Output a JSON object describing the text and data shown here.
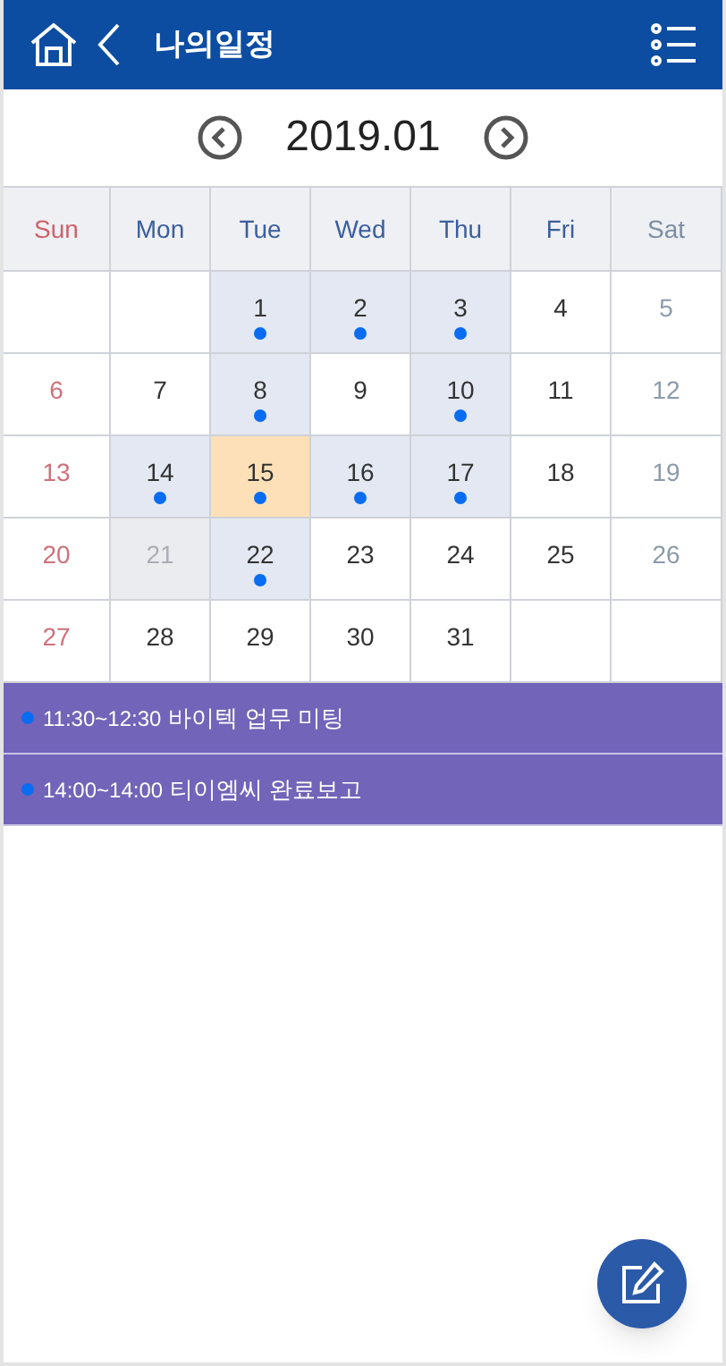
{
  "header": {
    "title": "나의일정"
  },
  "month": {
    "label": "2019.01"
  },
  "weekdays": [
    {
      "label": "Sun",
      "kind": "sun"
    },
    {
      "label": "Mon",
      "kind": "weekday"
    },
    {
      "label": "Tue",
      "kind": "weekday"
    },
    {
      "label": "Wed",
      "kind": "weekday"
    },
    {
      "label": "Thu",
      "kind": "weekday"
    },
    {
      "label": "Fri",
      "kind": "weekday"
    },
    {
      "label": "Sat",
      "kind": "sat"
    }
  ],
  "weeks": [
    [
      {
        "kind": "empty"
      },
      {
        "kind": "empty"
      },
      {
        "kind": "day",
        "day": "1",
        "has_event": true,
        "selected": false,
        "disabled": false
      },
      {
        "kind": "day",
        "day": "2",
        "has_event": true,
        "selected": false,
        "disabled": false
      },
      {
        "kind": "day",
        "day": "3",
        "has_event": true,
        "selected": false,
        "disabled": false
      },
      {
        "kind": "day",
        "day": "4",
        "has_event": false,
        "selected": false,
        "disabled": false
      },
      {
        "kind": "day",
        "day": "5",
        "has_event": false,
        "selected": false,
        "disabled": false
      }
    ],
    [
      {
        "kind": "day",
        "day": "6",
        "has_event": false,
        "selected": false,
        "disabled": false
      },
      {
        "kind": "day",
        "day": "7",
        "has_event": false,
        "selected": false,
        "disabled": false
      },
      {
        "kind": "day",
        "day": "8",
        "has_event": true,
        "selected": false,
        "disabled": false
      },
      {
        "kind": "day",
        "day": "9",
        "has_event": false,
        "selected": false,
        "disabled": false
      },
      {
        "kind": "day",
        "day": "10",
        "has_event": true,
        "selected": false,
        "disabled": false
      },
      {
        "kind": "day",
        "day": "11",
        "has_event": false,
        "selected": false,
        "disabled": false
      },
      {
        "kind": "day",
        "day": "12",
        "has_event": false,
        "selected": false,
        "disabled": false
      }
    ],
    [
      {
        "kind": "day",
        "day": "13",
        "has_event": false,
        "selected": false,
        "disabled": false
      },
      {
        "kind": "day",
        "day": "14",
        "has_event": true,
        "selected": false,
        "disabled": false
      },
      {
        "kind": "day",
        "day": "15",
        "has_event": true,
        "selected": true,
        "disabled": false
      },
      {
        "kind": "day",
        "day": "16",
        "has_event": true,
        "selected": false,
        "disabled": false
      },
      {
        "kind": "day",
        "day": "17",
        "has_event": true,
        "selected": false,
        "disabled": false
      },
      {
        "kind": "day",
        "day": "18",
        "has_event": false,
        "selected": false,
        "disabled": false
      },
      {
        "kind": "day",
        "day": "19",
        "has_event": false,
        "selected": false,
        "disabled": false
      }
    ],
    [
      {
        "kind": "day",
        "day": "20",
        "has_event": false,
        "selected": false,
        "disabled": false
      },
      {
        "kind": "day",
        "day": "21",
        "has_event": false,
        "selected": false,
        "disabled": true
      },
      {
        "kind": "day",
        "day": "22",
        "has_event": true,
        "selected": false,
        "disabled": false
      },
      {
        "kind": "day",
        "day": "23",
        "has_event": false,
        "selected": false,
        "disabled": false
      },
      {
        "kind": "day",
        "day": "24",
        "has_event": false,
        "selected": false,
        "disabled": false
      },
      {
        "kind": "day",
        "day": "25",
        "has_event": false,
        "selected": false,
        "disabled": false
      },
      {
        "kind": "day",
        "day": "26",
        "has_event": false,
        "selected": false,
        "disabled": false
      }
    ],
    [
      {
        "kind": "day",
        "day": "27",
        "has_event": false,
        "selected": false,
        "disabled": false
      },
      {
        "kind": "day",
        "day": "28",
        "has_event": false,
        "selected": false,
        "disabled": false
      },
      {
        "kind": "day",
        "day": "29",
        "has_event": false,
        "selected": false,
        "disabled": false
      },
      {
        "kind": "day",
        "day": "30",
        "has_event": false,
        "selected": false,
        "disabled": false
      },
      {
        "kind": "day",
        "day": "31",
        "has_event": false,
        "selected": false,
        "disabled": false
      },
      {
        "kind": "empty"
      },
      {
        "kind": "empty"
      }
    ]
  ],
  "events": [
    {
      "time": "11:30~12:30",
      "title": "바이텍 업무 미팅"
    },
    {
      "time": "14:00~14:00",
      "title": "티이엠씨 완료보고"
    }
  ]
}
